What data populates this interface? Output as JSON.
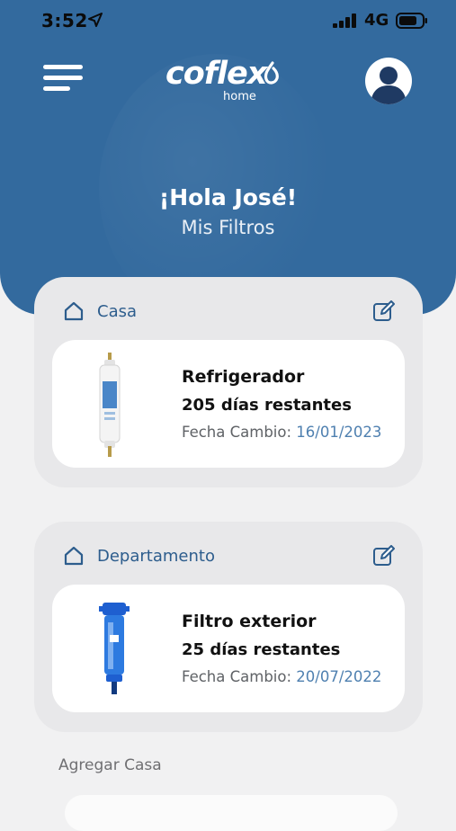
{
  "status": {
    "time": "3:52",
    "network": "4G"
  },
  "header": {
    "logo_text": "coflex",
    "logo_sub": "home",
    "greeting": "¡Hola José!",
    "subtitle": "Mis Filtros"
  },
  "groups": [
    {
      "title": "Casa",
      "filter": {
        "name": "Refrigerador",
        "days": "205 días restantes",
        "change_label": "Fecha Cambio:",
        "change_date": "16/01/2023"
      }
    },
    {
      "title": "Departamento",
      "filter": {
        "name": "Filtro exterior",
        "days": "25 días restantes",
        "change_label": "Fecha Cambio:",
        "change_date": "20/07/2022"
      }
    }
  ],
  "add_house_label": "Agregar Casa",
  "colors": {
    "header": "#336a9e",
    "accent": "#2d5d8d",
    "date": "#4f80b0",
    "background": "#f1f1f2"
  },
  "icons": [
    "location-arrow-icon",
    "signal-icon",
    "battery-icon",
    "menu-icon",
    "user-avatar-icon",
    "home-icon",
    "edit-icon"
  ]
}
